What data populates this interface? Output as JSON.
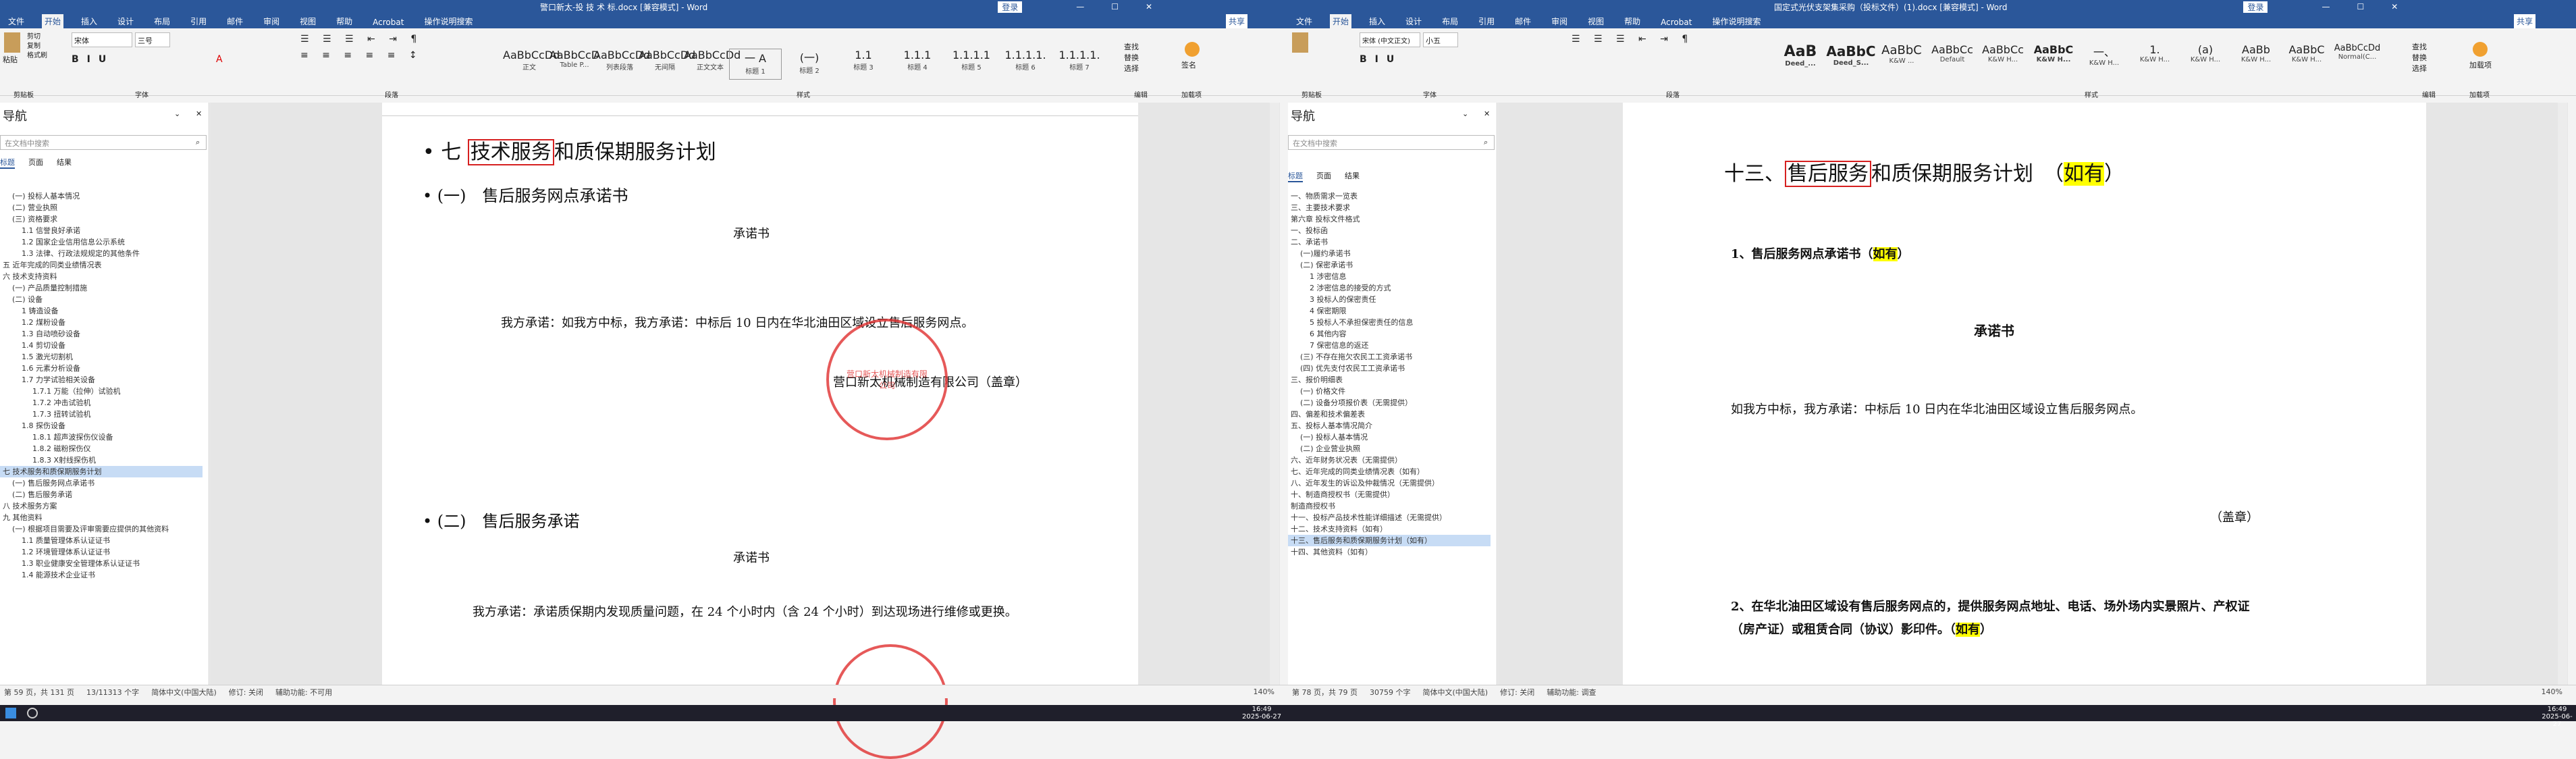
{
  "left": {
    "title_bar": "警口新太-投 技 术 标.docx [兼容模式] - Word",
    "user": "登录",
    "share": "共享",
    "tabs": [
      "文件",
      "开始",
      "插入",
      "设计",
      "布局",
      "引用",
      "邮件",
      "审阅",
      "视图",
      "帮助",
      "Acrobat",
      "操作说明搜索"
    ],
    "clipboard": [
      "剪切",
      "复制",
      "格式刷"
    ],
    "paste": "粘贴",
    "font_name": "宋体",
    "font_size": "三号",
    "styles": [
      {
        "preview": "AaBbCcDd",
        "name": "正文"
      },
      {
        "preview": "AaBbCcD",
        "name": "Table P..."
      },
      {
        "preview": "AaBbCcDd",
        "name": "列表段落"
      },
      {
        "preview": "AaBbCcDd",
        "name": "无间隔"
      },
      {
        "preview": "AaBbCcDd",
        "name": "正文文本"
      },
      {
        "preview": "一 A",
        "name": "标题 1"
      },
      {
        "preview": "(一)",
        "name": "标题 2"
      },
      {
        "preview": "1.1",
        "name": "标题 3"
      },
      {
        "preview": "1.1.1",
        "name": "标题 4"
      },
      {
        "preview": "1.1.1.1",
        "name": "标题 5"
      },
      {
        "preview": "1.1.1.1.",
        "name": "标题 6"
      },
      {
        "preview": "1.1.1.1.",
        "name": "标题 7"
      }
    ],
    "editing": [
      "查找",
      "替换",
      "选择"
    ],
    "sign": "签名",
    "groups": [
      "剪贴板",
      "字体",
      "段落",
      "样式",
      "编辑",
      "加载项"
    ],
    "nav_title": "导航",
    "nav_search": "在文档中搜索",
    "nav_tabs": [
      "标题",
      "页面",
      "结果"
    ],
    "nav_items": [
      "(一) 投标人基本情况",
      "(二) 营业执照",
      "(三) 资格要求",
      "1.1 信誉良好承诺",
      "1.2 国家企业信用信息公示系统",
      "1.3 法律、行政法规规定的其他条件",
      "五 近年完成的同类业绩情况表",
      "六 技术支持资料",
      "(一) 产品质量控制措施",
      "(二) 设备",
      "1 铸造设备",
      "1.2 煤粉设备",
      "1.3 自动喷砂设备",
      "1.4 剪切设备",
      "1.5 激光切割机",
      "1.6 元素分析设备",
      "1.7 力学试验相关设备",
      "1.7.1 万能（拉伸）试验机",
      "1.7.2 冲击试验机",
      "1.7.3 扭转试验机",
      "1.8 探伤设备",
      "1.8.1 超声波探伤仪设备",
      "1.8.2 磁粉探伤仪",
      "1.8.3 X射线探伤机",
      "七 技术服务和质保期服务计划",
      "(一) 售后服务网点承诺书",
      "(二) 售后服务承诺",
      "八 技术服务方案",
      "九 其他资料",
      "(一) 根据项目需要及评审需要应提供的其他资料",
      "1.1 质量管理体系认证证书",
      "1.2 环境管理体系认证证书",
      "1.3 职业健康安全管理体系认证证书",
      "1.4 能源技术企业证书"
    ],
    "nav_selected": 24,
    "doc": {
      "heading_pre": "七 ",
      "heading_box": "技术服务",
      "heading_post": "和质保期服务计划",
      "sub1": "(一)　售后服务网点承诺书",
      "promise_title": "承诺书",
      "promise_text": "我方承诺：如我方中标，我方承诺：中标后 10 日内在华北油田区域设立售后服务网点。",
      "company": "营口新太机械制造有限公司（盖章）",
      "stamp_text": "营口新太机械制造有限公司",
      "sub2": "(二)　售后服务承诺",
      "promise_title2": "承诺书",
      "promise_text2": "我方承诺：承诺质保期内发现质量问题，在 24 个小时内（含 24 个小时）到达现场进行维修或更换。"
    },
    "status": [
      "第 59 页，共 131 页",
      "13/11313 个字",
      "简体中文(中国大陆)",
      "修订: 关闭",
      "辅助功能: 不可用"
    ],
    "zoom": "140%"
  },
  "right": {
    "title_bar": "国定式光伏支架集采购（投标文件）(1).docx [兼容模式] - Word",
    "user": "登录",
    "share": "共享",
    "tabs": [
      "文件",
      "开始",
      "插入",
      "设计",
      "布局",
      "引用",
      "邮件",
      "审阅",
      "视图",
      "帮助",
      "Acrobat",
      "操作说明搜索"
    ],
    "font_name": "宋体 (中文正文)",
    "font_size": "小五",
    "styles": [
      {
        "preview": "AaB",
        "name": "Deed_..."
      },
      {
        "preview": "AaBbC",
        "name": "Deed_S..."
      },
      {
        "preview": "AaBbC",
        "name": "K&W ..."
      },
      {
        "preview": "AaBbCc",
        "name": "Default"
      },
      {
        "preview": "AaBbCc",
        "name": "K&W H..."
      },
      {
        "preview": "AaBbC",
        "name": "K&W H..."
      },
      {
        "preview": "一、",
        "name": "K&W H..."
      },
      {
        "preview": "1.",
        "name": "K&W H..."
      },
      {
        "preview": "(a)",
        "name": "K&W H..."
      },
      {
        "preview": "AaBb",
        "name": "K&W H..."
      },
      {
        "preview": "AaBbC",
        "name": "K&W H..."
      },
      {
        "preview": "AaBbCcDd",
        "name": "Normal(C..."
      }
    ],
    "editing": [
      "查找",
      "替换",
      "选择"
    ],
    "sign": "加载项",
    "groups": [
      "剪贴板",
      "字体",
      "段落",
      "样式",
      "编辑",
      "加载项"
    ],
    "nav_title": "导航",
    "nav_search": "在文档中搜索",
    "nav_tabs": [
      "标题",
      "页面",
      "结果"
    ],
    "nav_items": [
      "一、物质需求一览表",
      "三、主要技术要求",
      "第六章 投标文件格式",
      "一、投标函",
      "二、承诺书",
      "(一)履约承诺书",
      "(二) 保密承诺书",
      "1 涉密信息",
      "2 涉密信息的接受的方式",
      "3 投标人的保密责任",
      "4 保密期限",
      "5 投标人不承担保密责任的信息",
      "6 其他内容",
      "7 保密信息的返还",
      "(三) 不存在拖欠农民工工资承诺书",
      "(四) 优先支付农民工工资承诺书",
      "三、报价明细表",
      "(一) 价格文件",
      "(二) 设备分项报价表（无需提供）",
      "四、偏差和技术偏差表",
      "五、投标人基本情况简介",
      "(一) 投标人基本情况",
      "(二) 企业营业执照",
      "六、近年财务状况表（无需提供）",
      "七、近年完成的同类业绩情况表（如有）",
      "八、近年发生的诉讼及仲裁情况（无需提供）",
      "十、制造商授权书（无需提供）",
      "制造商授权书",
      "十一、投标产品技术性能详细描述（无需提供）",
      "十二、技术支持资料（如有）",
      "十三、售后服务和质保期服务计划（如有）",
      "十四、其他资料（如有）"
    ],
    "nav_selected": 30,
    "doc": {
      "heading_pre": "十三、",
      "heading_box": "售后服务",
      "heading_mid": "和质保期服务计划　（",
      "heading_hl": "如有",
      "heading_post": "）",
      "item1_pre": "1、售后服务网点承诺书（",
      "item1_hl": "如有",
      "item1_post": "）",
      "promise_title": "承诺书",
      "promise_text": "如我方中标，我方承诺：中标后 10 日内在华北油田区域设立售后服务网点。",
      "seal": "（盖章）",
      "item2": "2、在华北油田区域设有售后服务网点的，提供服务网点地址、电话、场外场内实景照片、产权证（房产证）或租赁合同（协议）影印件。（",
      "item2_hl": "如有",
      "item2_post": "）"
    },
    "status": [
      "第 78 页，共 79 页",
      "30759 个字",
      "简体中文(中国大陆)",
      "修订: 关闭",
      "辅助功能: 调查"
    ],
    "zoom": "140%"
  },
  "taskbar": {
    "time_left": "16:49",
    "date_left": "2025-06-27",
    "time_right": "16:49",
    "date_right": "2025-06-27"
  }
}
